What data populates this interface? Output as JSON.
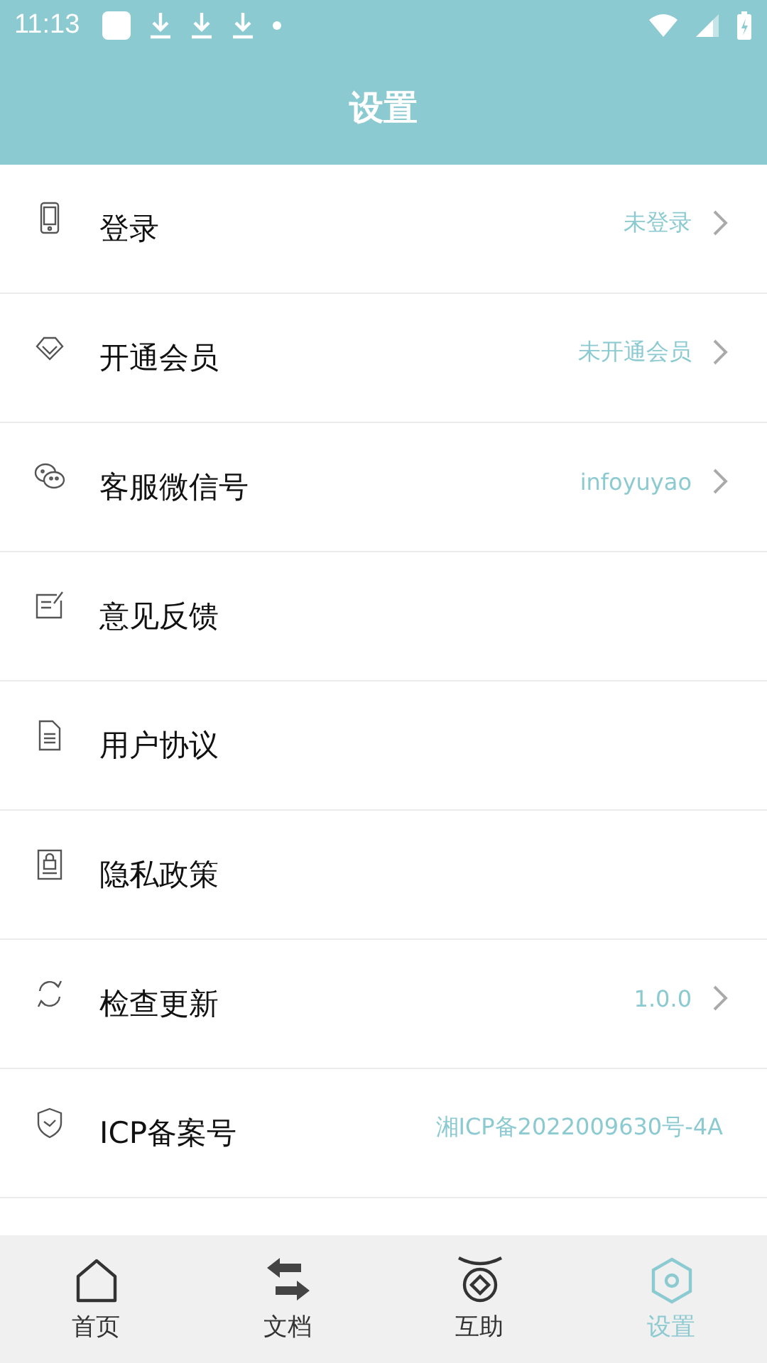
{
  "status_bar": {
    "time": "11:13"
  },
  "header": {
    "title": "设置"
  },
  "settings": [
    {
      "label": "登录",
      "value": "未登录",
      "chevron": true
    },
    {
      "label": "开通会员",
      "value": "未开通会员",
      "chevron": true
    },
    {
      "label": "客服微信号",
      "value": "infoyuyao",
      "chevron": true
    },
    {
      "label": "意见反馈",
      "chevron": false
    },
    {
      "label": "用户协议",
      "chevron": false
    },
    {
      "label": "隐私政策",
      "chevron": false
    },
    {
      "label": "检查更新",
      "value": "1.0.0",
      "chevron": true
    },
    {
      "label": "ICP备案号",
      "value": "湘ICP备2022009630号-4A",
      "chevron": false
    }
  ],
  "tabs": [
    {
      "label": "首页",
      "selected": false
    },
    {
      "label": "文档",
      "selected": false
    },
    {
      "label": "互助",
      "selected": false
    },
    {
      "label": "设置",
      "selected": true
    }
  ]
}
